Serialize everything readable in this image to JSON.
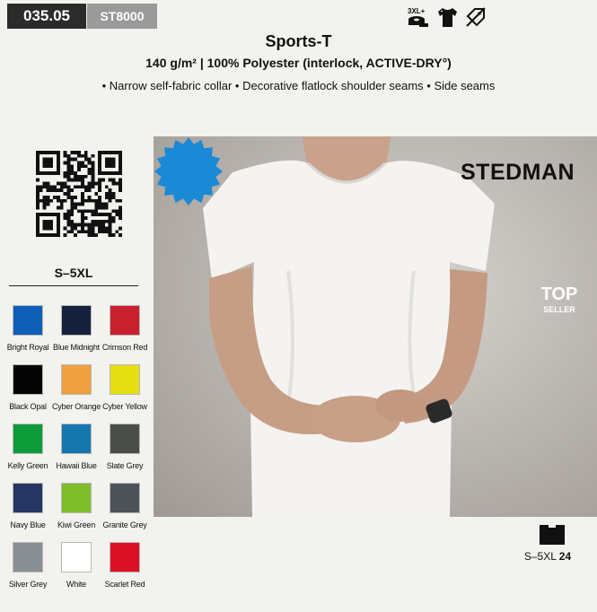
{
  "header": {
    "article_number": "035.05",
    "sku": "ST8000",
    "feature_icons": [
      "extended-size-3xl-plus-icon",
      "tshirt-icon",
      "no-label-icon"
    ],
    "feature_icon_text": "3XL+"
  },
  "product": {
    "name": "Sports-T",
    "spec": "140 g/m² | 100% Polyester (interlock, ACTIVE-DRY°)",
    "features": "• Narrow self-fabric collar • Decorative flatlock shoulder seams • Side seams"
  },
  "size_range": "S–5XL",
  "colors": [
    {
      "name": "Bright Royal",
      "hex": "#0d5fb8"
    },
    {
      "name": "Blue Midnight",
      "hex": "#16213d"
    },
    {
      "name": "Crimson Red",
      "hex": "#c8202c"
    },
    {
      "name": "Black Opal",
      "hex": "#050505"
    },
    {
      "name": "Cyber Orange",
      "hex": "#f0a041"
    },
    {
      "name": "Cyber Yellow",
      "hex": "#e5de10"
    },
    {
      "name": "Kelly Green",
      "hex": "#0d9b3a"
    },
    {
      "name": "Hawaii Blue",
      "hex": "#1677ad"
    },
    {
      "name": "Slate Grey",
      "hex": "#4a4d4a"
    },
    {
      "name": "Navy Blue",
      "hex": "#263561"
    },
    {
      "name": "Kiwi Green",
      "hex": "#7fbe2a"
    },
    {
      "name": "Granite Grey",
      "hex": "#4d5358"
    },
    {
      "name": "Silver Grey",
      "hex": "#8a8f95"
    },
    {
      "name": "White",
      "hex": "#ffffff"
    },
    {
      "name": "Scarlet Red",
      "hex": "#dc1126"
    }
  ],
  "photo": {
    "brand": "STEDMAN",
    "badge_top": "TOP",
    "badge_sub": "SELLER"
  },
  "packaging": {
    "icon": "carton-box-icon",
    "sizes": "S–5XL",
    "quantity": "24"
  },
  "accent_color": "#1a8ad6"
}
